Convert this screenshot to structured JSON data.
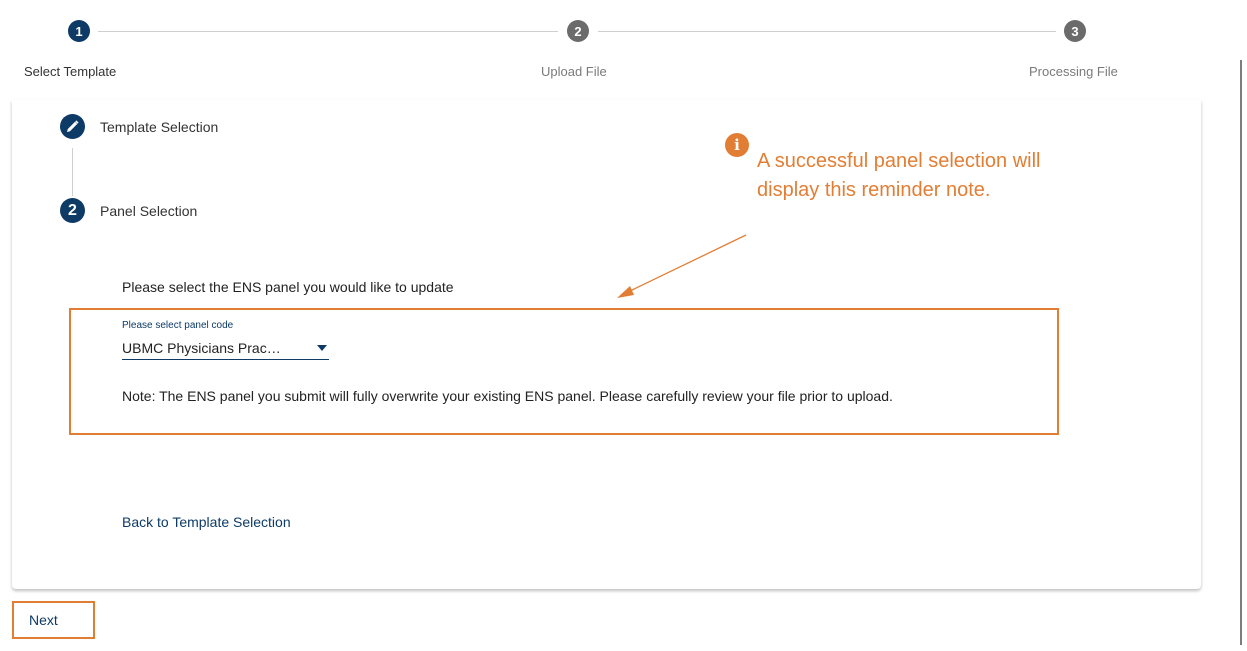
{
  "stepper": {
    "steps": [
      {
        "number": "1",
        "label": "Select Template",
        "active": true
      },
      {
        "number": "2",
        "label": "Upload File",
        "active": false
      },
      {
        "number": "3",
        "label": "Processing File",
        "active": false
      }
    ]
  },
  "vertical_steps": {
    "template": {
      "label": "Template Selection",
      "icon": "pencil-icon"
    },
    "panel": {
      "number": "2",
      "label": "Panel Selection"
    }
  },
  "panel": {
    "prompt": "Please select the ENS panel you would like to update",
    "field_label": "Please select panel code",
    "selected_value": "UBMC Physicians Prac…",
    "note": "Note: The ENS panel you submit will fully overwrite your existing ENS panel. Please carefully review your file prior to upload."
  },
  "actions": {
    "back_link": "Back to Template Selection",
    "next": "Next"
  },
  "callout": {
    "icon": "info-icon",
    "text": "A successful panel selection will display this reminder note."
  },
  "colors": {
    "primary": "#0d3b66",
    "inactive_step": "#6b6b6b",
    "annotation": "#e27e34"
  }
}
